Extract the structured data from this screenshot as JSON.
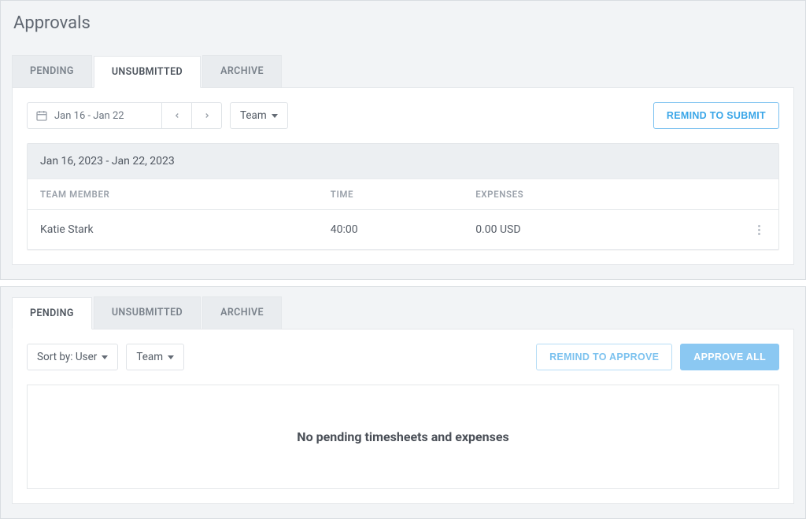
{
  "page_title": "Approvals",
  "section1": {
    "tabs": [
      {
        "label": "PENDING",
        "active": false
      },
      {
        "label": "UNSUBMITTED",
        "active": true
      },
      {
        "label": "ARCHIVE",
        "active": false
      }
    ],
    "date_range_short": "Jan 16 - Jan 22",
    "team_dropdown": "Team",
    "remind_button": "REMIND TO SUBMIT",
    "table": {
      "header": "Jan 16, 2023 - Jan 22, 2023",
      "columns": {
        "member": "TEAM MEMBER",
        "time": "TIME",
        "expenses": "EXPENSES"
      },
      "rows": [
        {
          "member": "Katie Stark",
          "time": "40:00",
          "expenses": "0.00 USD"
        }
      ]
    }
  },
  "section2": {
    "tabs": [
      {
        "label": "PENDING",
        "active": true
      },
      {
        "label": "UNSUBMITTED",
        "active": false
      },
      {
        "label": "ARCHIVE",
        "active": false
      }
    ],
    "sort_dropdown": "Sort by: User",
    "team_dropdown": "Team",
    "remind_button": "REMIND TO APPROVE",
    "approve_all_button": "APPROVE ALL",
    "empty_message": "No pending timesheets and expenses"
  }
}
